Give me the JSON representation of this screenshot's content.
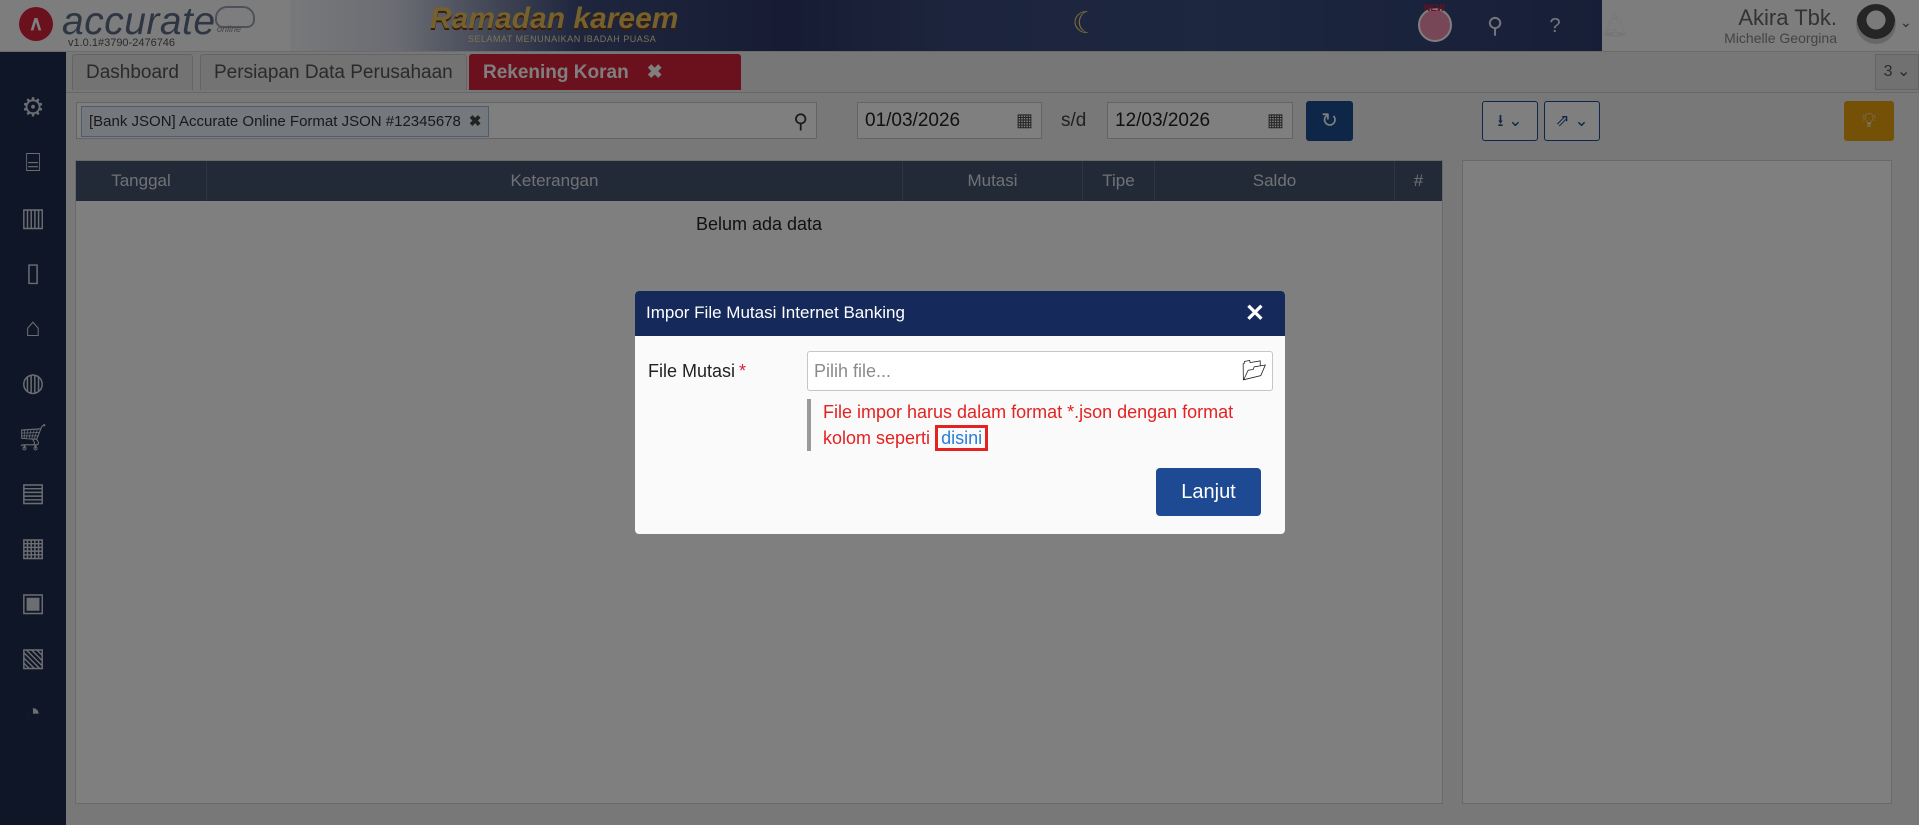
{
  "header": {
    "brand": "accurate",
    "brand_sub": "online",
    "version": "v1.0.1#3790-2476746",
    "banner_title": "Ramadan kareem",
    "banner_sub": "SELAMAT MENUNAIKAN IBADAH PUASA",
    "new_badge": "NEW",
    "user_name": "Akira Tbk.",
    "user_sub": "Michelle Georgina"
  },
  "tabs": {
    "items": [
      {
        "label": "Dashboard"
      },
      {
        "label": "Persiapan Data Perusahaan"
      },
      {
        "label": "Rekening Koran"
      }
    ],
    "close_glyph": "✖",
    "count": "3"
  },
  "toolbar": {
    "bank_tag": "[Bank JSON] Accurate Online Format JSON #12345678",
    "date_from": "01/03/2026",
    "sd_label": "s/d",
    "date_to": "12/03/2026"
  },
  "table": {
    "columns": [
      "Tanggal",
      "Keterangan",
      "Mutasi",
      "Tipe",
      "Saldo",
      "#"
    ],
    "empty_text": "Belum ada data"
  },
  "modal": {
    "title": "Impor File Mutasi Internet Banking",
    "field_label": "File Mutasi",
    "required_mark": "*",
    "placeholder": "Pilih file...",
    "note_text": "File impor harus dalam format *.json dengan format kolom seperti",
    "note_link": "disini",
    "submit_label": "Lanjut"
  },
  "colors": {
    "sidebar": "#1d2c50",
    "active_tab": "#d6223b",
    "primary_button": "#1d4a93",
    "error_text": "#e32222",
    "link": "#2a7ed8"
  }
}
